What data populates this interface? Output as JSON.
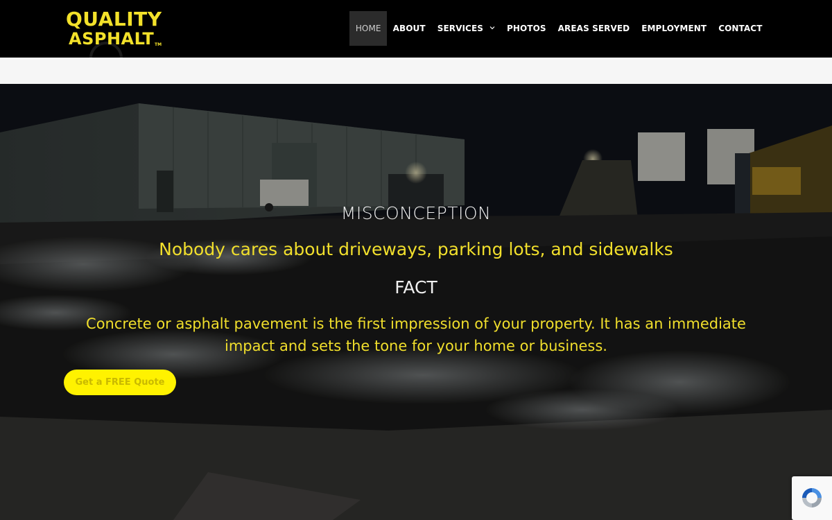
{
  "header": {
    "logo": {
      "line1": "QUALITY",
      "line2": "ASPHALT",
      "tm": "TM"
    },
    "nav": [
      {
        "label": "HOME",
        "active": true
      },
      {
        "label": "ABOUT"
      },
      {
        "label": "SERVICES",
        "has_dropdown": true
      },
      {
        "label": "PHOTOS"
      },
      {
        "label": "AREAS SERVED"
      },
      {
        "label": "EMPLOYMENT"
      },
      {
        "label": "CONTACT"
      }
    ]
  },
  "hero": {
    "heading1": "MISCONCEPTION",
    "text1": "Nobody cares about driveways, parking lots, and sidewalks",
    "heading2": "FACT",
    "text2": "Concrete or asphalt pavement is the first impression of your property. It has an immediate impact and sets the tone for your home or business.",
    "cta_label": "Get a FREE Quote"
  },
  "icons": {
    "dropdown": "chevron-down-icon",
    "recaptcha": "recaptcha-icon"
  },
  "colors": {
    "brand_yellow": "#f1df2c",
    "button_yellow": "#fff200",
    "header_bg": "#000000",
    "strip_bg": "#f6f6f6",
    "active_nav_bg": "#2b2b2b"
  }
}
